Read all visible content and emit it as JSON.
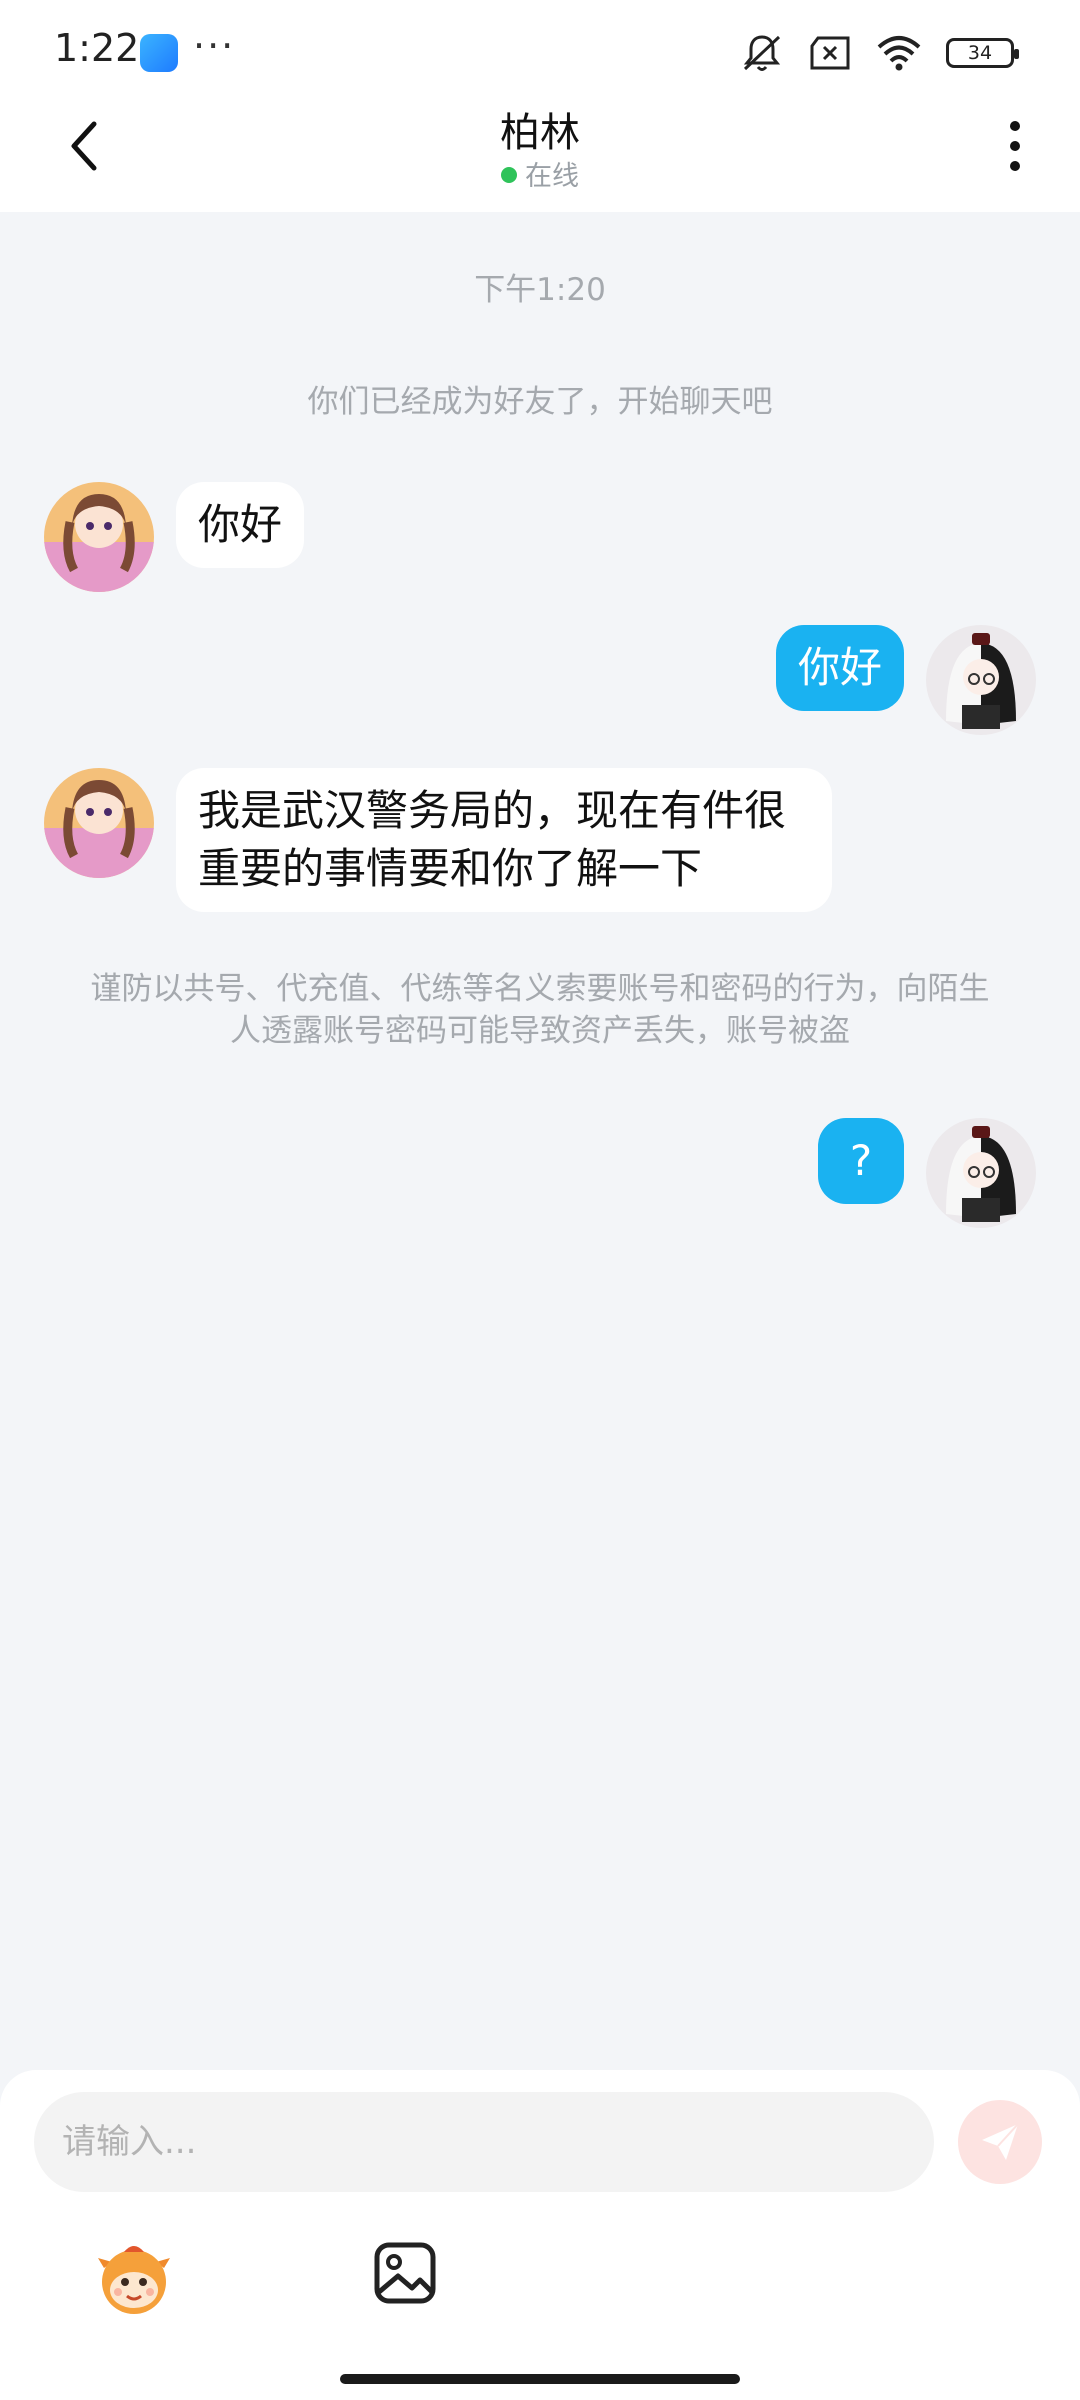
{
  "status_bar": {
    "time": "1:22",
    "dots": "···",
    "battery": "34",
    "icons": [
      "app-icon",
      "mute-icon",
      "sim-off-icon",
      "wifi-icon",
      "battery-icon"
    ]
  },
  "header": {
    "title": "柏林",
    "status": "在线",
    "status_color": "#2fc35a"
  },
  "chat": {
    "timestamp": "下午1:20",
    "friend_notice": "你们已经成为好友了，开始聊天吧",
    "messages": [
      {
        "side": "left",
        "text": "你好"
      },
      {
        "side": "right",
        "text": "你好"
      },
      {
        "side": "left",
        "text": "我是武汉警务局的，现在有件很重要的事情要和你了解一下"
      },
      {
        "side": "right",
        "text": "?"
      }
    ],
    "warning": "谨防以共号、代充值、代练等名义索要账号和密码的行为，向陌生人透露账号密码可能导致资产丢失，账号被盗"
  },
  "input": {
    "placeholder": "请输入...",
    "value": ""
  },
  "colors": {
    "bubble_right": "#1ab2f1",
    "bubble_left": "#ffffff",
    "send_button": "#fde3e1",
    "background": "#f3f5f8"
  }
}
